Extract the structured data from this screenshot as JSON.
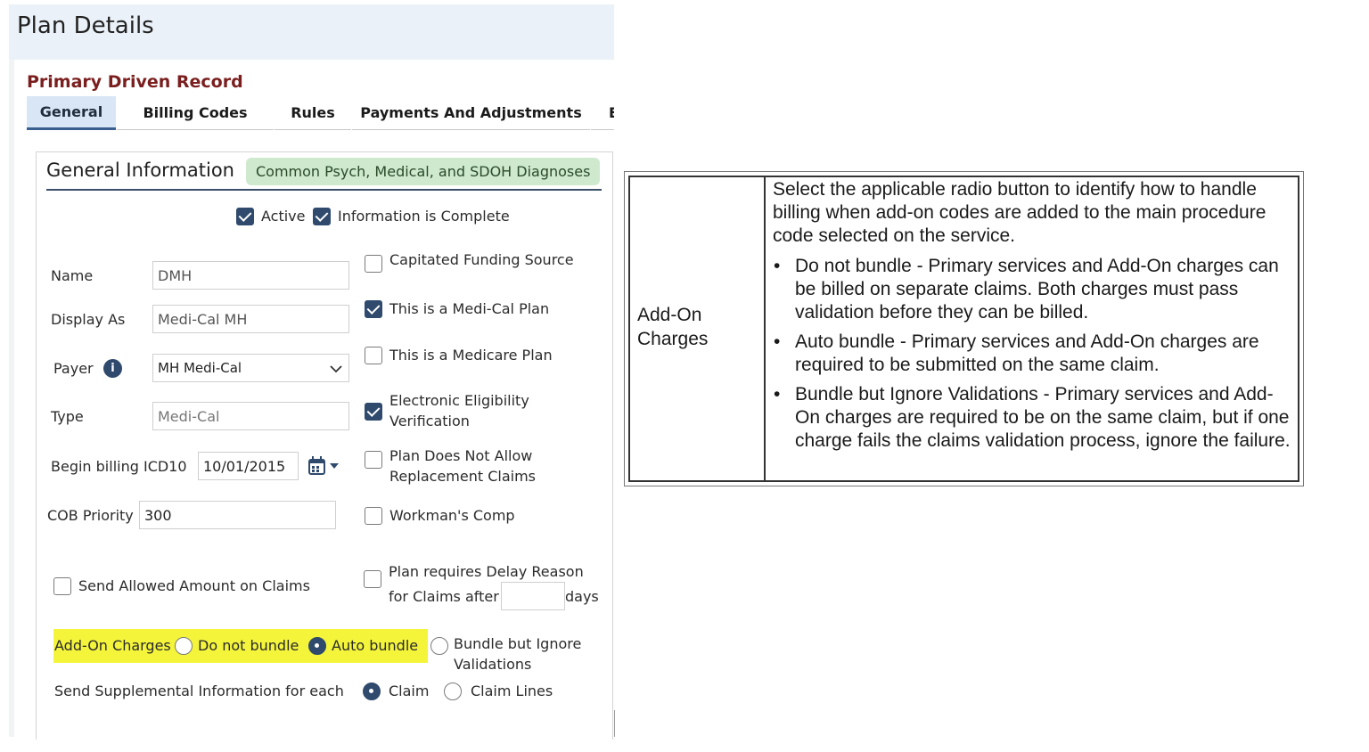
{
  "page": {
    "title": "Plan Details",
    "record_title": "Primary Driven Record"
  },
  "tabs": [
    {
      "label": "General",
      "active": true
    },
    {
      "label": "Billing Codes"
    },
    {
      "label": "Rules"
    },
    {
      "label": "Payments And Adjustments"
    },
    {
      "label": "Eligi"
    }
  ],
  "section": {
    "title": "General Information",
    "badge": "Common Psych, Medical, and SDOH Diagnoses"
  },
  "status": {
    "active_label": "Active",
    "active_checked": true,
    "complete_label": "Information is Complete",
    "complete_checked": true
  },
  "fields": {
    "name": {
      "label": "Name",
      "value": "DMH"
    },
    "display_as": {
      "label": "Display As",
      "value": "Medi-Cal MH"
    },
    "payer": {
      "label": "Payer",
      "value": "MH Medi-Cal"
    },
    "type": {
      "label": "Type",
      "value": "Medi-Cal"
    },
    "begin_billing": {
      "label": "Begin billing ICD10",
      "value": "10/01/2015"
    },
    "cob_priority": {
      "label": "COB Priority",
      "value": "300"
    }
  },
  "checks": {
    "capitated": {
      "label": "Capitated Funding Source",
      "checked": false
    },
    "medi_cal": {
      "label": "This is a Medi-Cal Plan",
      "checked": true
    },
    "medicare": {
      "label": "This is a Medicare Plan",
      "checked": false
    },
    "eev_line1": "Electronic Eligibility",
    "eev_line2": "Verification",
    "eev_checked": true,
    "no_replace_line1": "Plan Does Not Allow",
    "no_replace_line2": "Replacement Claims",
    "no_replace_checked": false,
    "workmans": {
      "label": "Workman's Comp",
      "checked": false
    },
    "send_allowed": {
      "label": "Send Allowed Amount on Claims",
      "checked": false
    },
    "delay_line1": "Plan requires Delay Reason",
    "delay_line2": "for Claims after",
    "delay_days": "days",
    "delay_value": "",
    "delay_checked": false
  },
  "addon": {
    "label": "Add-On Charges",
    "options": [
      "Do not bundle",
      "Auto bundle",
      "Bundle but Ignore",
      "Validations"
    ],
    "selected": "Auto bundle",
    "highlight_color": "#f4f53b"
  },
  "supplemental": {
    "label": "Send Supplemental Information for each",
    "options": [
      "Claim",
      "Claim Lines"
    ],
    "selected": "Claim"
  },
  "reference": {
    "label_line1": "Add-On",
    "label_line2": "Charges",
    "intro": "Select the applicable radio button to identify how to handle billing when add-on codes are added to the main procedure code selected on the service.",
    "bullets": [
      "Do not bundle - Primary services and Add-On charges can be billed on separate claims. Both charges must pass validation before they can be billed.",
      "Auto bundle - Primary services and Add-On charges are required to be submitted on the same claim.",
      "Bundle but Ignore Validations - Primary services and Add-On charges are required to be on the same claim, but if one charge fails the claims validation process, ignore the failure."
    ],
    "bullet_char": "•"
  },
  "colors": {
    "accent": "#2f4a6d",
    "record_title": "#7a1e1e",
    "badge_bg": "#cfe9cf",
    "header_bg": "#eaf1f8"
  }
}
